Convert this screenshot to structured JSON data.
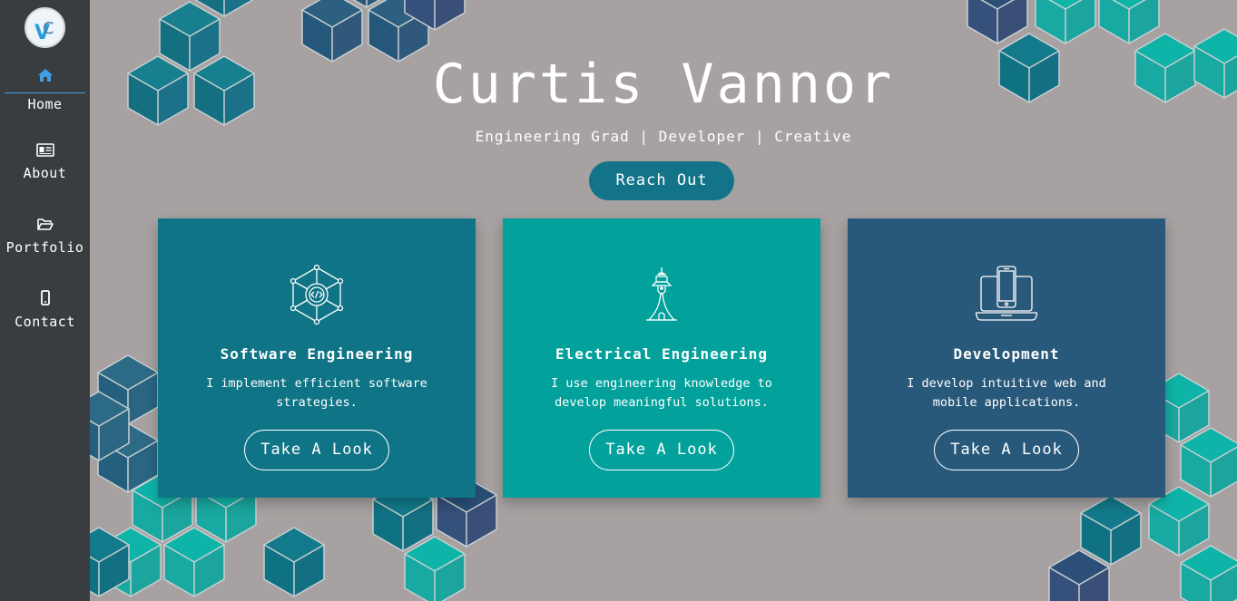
{
  "sidebar": {
    "logo_text": "VC",
    "items": [
      {
        "label": "Home",
        "icon": "home-icon",
        "active": true
      },
      {
        "label": "About",
        "icon": "id-card-icon",
        "active": false
      },
      {
        "label": "Portfolio",
        "icon": "folder-open-icon",
        "active": false
      },
      {
        "label": "Contact",
        "icon": "mobile-phone-icon",
        "active": false
      }
    ]
  },
  "hero": {
    "name": "Curtis Vannor",
    "subtitle": "Engineering Grad | Developer | Creative",
    "cta_label": "Reach Out"
  },
  "cards": [
    {
      "title": "Software Engineering",
      "description": "I implement efficient software strategies.",
      "button_label": "Take A Look",
      "icon": "code-network-icon",
      "color": "#0f7485"
    },
    {
      "title": "Electrical Engineering",
      "description": "I use engineering knowledge to develop meaningful solutions.",
      "button_label": "Take A Look",
      "icon": "tower-icon",
      "color": "#02a19c"
    },
    {
      "title": "Development",
      "description": "I develop intuitive web and mobile applications.",
      "button_label": "Take A Look",
      "icon": "laptop-phone-icon",
      "color": "#29597a"
    }
  ],
  "colors": {
    "sidebar_bg": "#3a3d40",
    "page_bg": "#a7a2a1",
    "accent_blue": "#3f9fe5",
    "teal_dark": "#0f7485",
    "teal_bright": "#02a19c",
    "navy": "#29597a"
  }
}
